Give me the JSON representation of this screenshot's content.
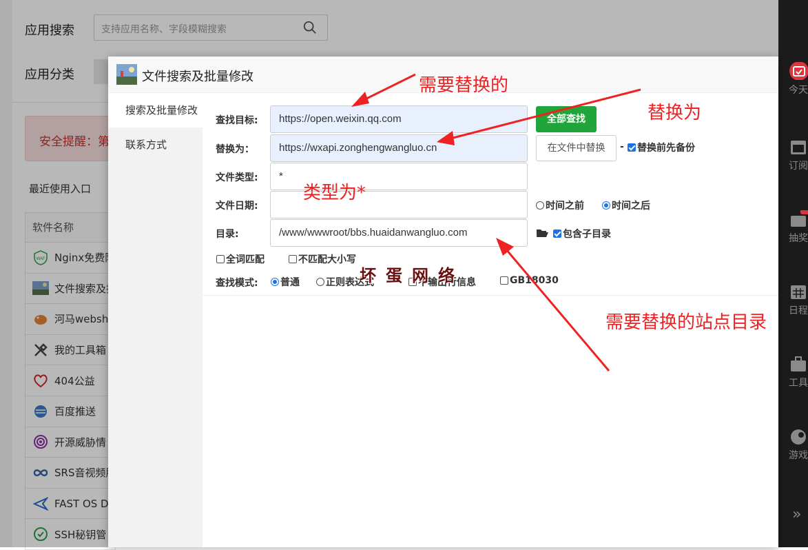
{
  "background": {
    "search_label": "应用搜索",
    "search_placeholder": "支持应用名称、字段模糊搜索",
    "category_label": "应用分类",
    "alert_text": "安全提醒：第",
    "recent_label": "最近使用入口",
    "table_header": "软件名称",
    "rows": [
      {
        "label": "Nginx免费防",
        "icon": "waf-shield-icon"
      },
      {
        "label": "文件搜索及批",
        "icon": "file-search-app-icon"
      },
      {
        "label": "河马websh",
        "icon": "hippo-webshell-icon"
      },
      {
        "label": "我的工具箱",
        "icon": "tools-icon"
      },
      {
        "label": "404公益",
        "icon": "heart-404-icon"
      },
      {
        "label": "百度推送",
        "icon": "baidu-push-icon"
      },
      {
        "label": "开源威胁情",
        "icon": "threat-intel-icon"
      },
      {
        "label": "SRS音视频服",
        "icon": "srs-infinity-icon"
      },
      {
        "label": "FAST OS D",
        "icon": "fast-os-icon"
      },
      {
        "label": "SSH秘钥管",
        "icon": "ssh-key-icon"
      }
    ]
  },
  "right_sidebar": {
    "items": [
      {
        "label": "今天",
        "icon": "calendar-check-icon"
      },
      {
        "label": "订阅",
        "icon": "calendar-icon"
      },
      {
        "label": "抽奖",
        "icon": "lottery-icon"
      },
      {
        "label": "日程",
        "icon": "schedule-icon"
      },
      {
        "label": "工具",
        "icon": "toolbox-icon"
      },
      {
        "label": "游戏",
        "icon": "game-icon"
      }
    ],
    "badge": "1"
  },
  "modal": {
    "title": "文件搜索及批量修改",
    "sidebar": [
      "搜索及批量修改",
      "联系方式"
    ],
    "form": {
      "find_label": "查找目标:",
      "find_value": "https://open.weixin.qq.com",
      "find_all_button": "全部查找",
      "replace_label": "替换为：",
      "replace_value": "https://wxapi.zonghengwangluo.cn",
      "replace_in_file_button": "在文件中替换",
      "dash": "-",
      "backup_label": "替换前先备份",
      "filetype_label": "文件类型:",
      "filetype_value": "*",
      "filedate_label": "文件日期:",
      "filedate_value": "",
      "time_before": "时间之前",
      "time_after": "时间之后",
      "dir_label": "目录:",
      "dir_value": "/www/wwwroot/bbs.huaidanwangluo.com",
      "include_subdir": "包含子目录",
      "whole_word": "全词匹配",
      "ignore_case": "不匹配大小写",
      "mode_label": "查找模式:",
      "mode_normal": "普通",
      "mode_regex": "正则表达式",
      "no_line_output": "不输出行信息",
      "gb18030": "GB18030"
    }
  },
  "annotations": {
    "need_replace": "需要替换的",
    "replace_with": "替换为",
    "type_is": "类型为*",
    "site_dir": "需要替换的站点目录",
    "watermark": "坏蛋网络"
  },
  "colors": {
    "primary_green": "#20a53a",
    "annotation_red": "#ee2222",
    "check_blue": "#1a73e8",
    "highlight_input": "#e8f0fe"
  }
}
